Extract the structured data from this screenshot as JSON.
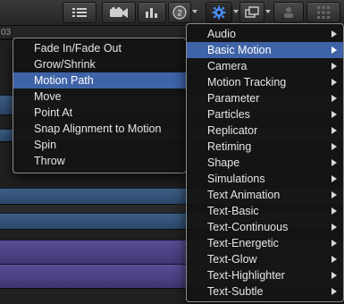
{
  "toolbar": {
    "icons": [
      "list-icon",
      "camera-icon",
      "bars-icon",
      "disc-2-icon",
      "gear-icon",
      "layers-icon",
      "person-icon",
      "grid-icon"
    ],
    "accent_color": "#3f63a7"
  },
  "timeline": {
    "ruler_label": "03"
  },
  "behavior_submenu": {
    "items": [
      {
        "label": "Fade In/Fade Out",
        "highlighted": false
      },
      {
        "label": "Grow/Shrink",
        "highlighted": false
      },
      {
        "label": "Motion Path",
        "highlighted": true
      },
      {
        "label": "Move",
        "highlighted": false
      },
      {
        "label": "Point At",
        "highlighted": false
      },
      {
        "label": "Snap Alignment to Motion",
        "highlighted": false
      },
      {
        "label": "Spin",
        "highlighted": false
      },
      {
        "label": "Throw",
        "highlighted": false
      }
    ]
  },
  "behaviors_menu": {
    "items": [
      {
        "label": "Audio",
        "highlighted": false
      },
      {
        "label": "Basic Motion",
        "highlighted": true
      },
      {
        "label": "Camera",
        "highlighted": false
      },
      {
        "label": "Motion Tracking",
        "highlighted": false
      },
      {
        "label": "Parameter",
        "highlighted": false
      },
      {
        "label": "Particles",
        "highlighted": false
      },
      {
        "label": "Replicator",
        "highlighted": false
      },
      {
        "label": "Retiming",
        "highlighted": false
      },
      {
        "label": "Shape",
        "highlighted": false
      },
      {
        "label": "Simulations",
        "highlighted": false
      },
      {
        "label": "Text Animation",
        "highlighted": false
      },
      {
        "label": "Text-Basic",
        "highlighted": false
      },
      {
        "label": "Text-Continuous",
        "highlighted": false
      },
      {
        "label": "Text-Energetic",
        "highlighted": false
      },
      {
        "label": "Text-Glow",
        "highlighted": false
      },
      {
        "label": "Text-Highlighter",
        "highlighted": false
      },
      {
        "label": "Text-Subtle",
        "highlighted": false
      }
    ]
  }
}
